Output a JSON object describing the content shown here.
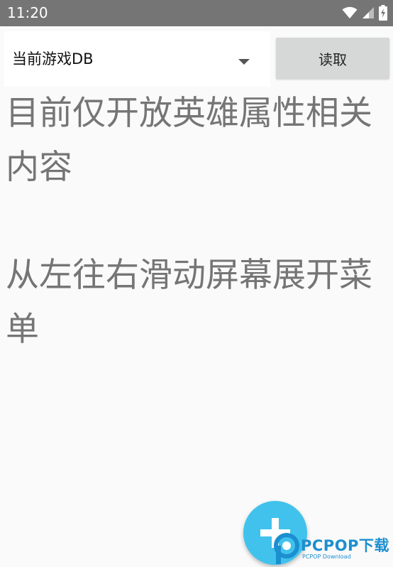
{
  "status_bar": {
    "time": "11:20",
    "icons": [
      "wifi-icon",
      "cellular-signal-icon",
      "battery-charging-icon"
    ]
  },
  "toolbar": {
    "spinner_value": "当前游戏DB",
    "read_button_label": "读取"
  },
  "main": {
    "info_line_1": "目前仅开放英雄属性相关内容",
    "info_line_2": "从左往右滑动屏幕展开菜单"
  },
  "fab": {
    "icon": "plus-icon",
    "color": "#40c2ec"
  },
  "watermark": {
    "text": "PCPOP下载",
    "subtext": "PCPOP Download"
  },
  "colors": {
    "status_bar": "#757575",
    "background": "#fafafa",
    "button": "#d6d7d7",
    "text_secondary": "#757575"
  }
}
